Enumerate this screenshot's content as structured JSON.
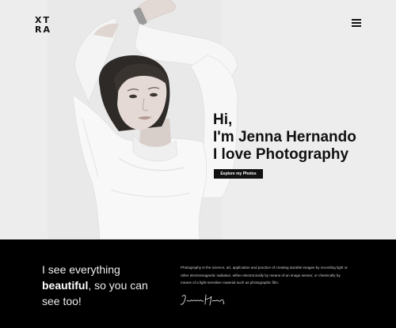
{
  "brand": {
    "logo_text": "XTRA"
  },
  "nav": {
    "menu_icon": "hamburger-menu-icon"
  },
  "hero": {
    "greeting_line1": "Hi,",
    "greeting_prefix": "I'm ",
    "name": "Jenna Hernando",
    "greeting_line3": "I love Photography",
    "cta_label": "Explore my Photos"
  },
  "intro": {
    "tagline_part1": "I see everything ",
    "tagline_bold": "beautiful",
    "tagline_part2": ", so you can see too!",
    "description": "Photography is the science, art, application and practice of creating durable images by recording light or other electromagnetic radiation, either electronically by means of an image sensor, or chemically by means of a light-sensitive material such as photographic film.",
    "signature": "Jenna Hernando"
  },
  "colors": {
    "band_bg": "#000000",
    "cta_bg": "#111111",
    "hero_bg": "#eeeeee"
  }
}
